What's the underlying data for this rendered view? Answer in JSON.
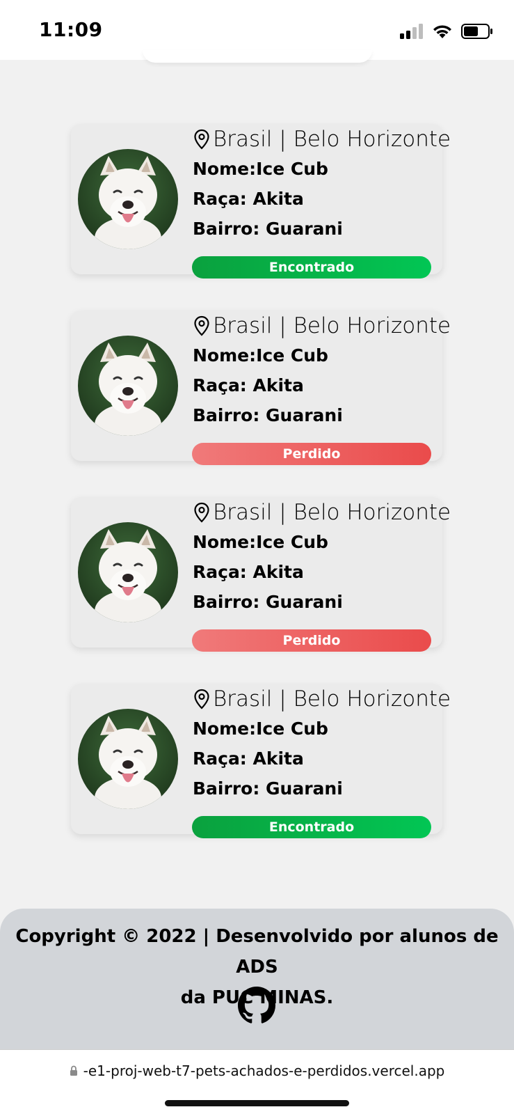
{
  "status_bar": {
    "time": "11:09",
    "icons": [
      "signal-icon",
      "wifi-icon",
      "battery-icon"
    ]
  },
  "colors": {
    "found": "#02c654",
    "lost": "#ea4b4b",
    "card_bg": "#ebebeb",
    "footer_bg": "#d2d5d9"
  },
  "pets": [
    {
      "location": "Brasil | Belo Horizonte",
      "name": "Nome:Ice Cub",
      "breed": "Raça: Akita",
      "neighborhood": "Bairro: Guarani",
      "status": "Encontrado",
      "status_type": "found"
    },
    {
      "location": "Brasil | Belo Horizonte",
      "name": "Nome:Ice Cub",
      "breed": "Raça: Akita",
      "neighborhood": "Bairro: Guarani",
      "status": "Perdido",
      "status_type": "lost"
    },
    {
      "location": "Brasil | Belo Horizonte",
      "name": "Nome:Ice Cub",
      "breed": "Raça: Akita",
      "neighborhood": "Bairro: Guarani",
      "status": "Perdido",
      "status_type": "lost"
    },
    {
      "location": "Brasil | Belo Horizonte",
      "name": "Nome:Ice Cub",
      "breed": "Raça: Akita",
      "neighborhood": "Bairro: Guarani",
      "status": "Encontrado",
      "status_type": "found"
    }
  ],
  "footer": {
    "copyright_line1": "Copyright © 2022 | Desenvolvido por alunos de ADS",
    "copyright_line2": "da PUC MINAS.",
    "icon": "github-icon"
  },
  "browser": {
    "url": "-e1-proj-web-t7-pets-achados-e-perdidos.vercel.app",
    "lock_icon": "lock-icon"
  }
}
